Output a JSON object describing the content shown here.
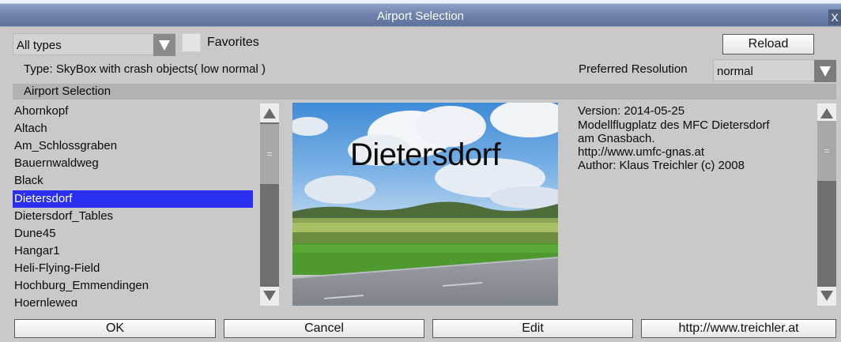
{
  "window": {
    "title": "Airport Selection",
    "close_glyph": "X",
    "close_icon": "close-icon"
  },
  "toolbar": {
    "type_filter": "All types",
    "favorites_label": "Favorites",
    "favorites_checked": false,
    "reload_label": "Reload"
  },
  "type_info": "Type: SkyBox with crash objects( low normal )",
  "resolution": {
    "label": "Preferred Resolution",
    "value": "normal"
  },
  "section_title": "Airport Selection",
  "airports": {
    "items": [
      "Ahornkopf",
      "Altach",
      "Am_Schlossgraben",
      "Bauernwaldweg",
      "Black",
      "Dietersdorf",
      "Dietersdorf_Tables",
      "Dune45",
      "Hangar1",
      "Heli-Flying-Field",
      "Hochburg_Emmendingen",
      "Hoernleweg"
    ],
    "selected": "Dietersdorf"
  },
  "preview": {
    "caption": "Dietersdorf"
  },
  "details": {
    "lines": [
      "Version: 2014-05-25",
      "Modellflugplatz des MFC Dietersdorf",
      "am Gnasbach.",
      "http://www.umfc-gnas.at",
      "Author: Klaus Treichler (c) 2008"
    ]
  },
  "scrollbar_grip": "=",
  "buttons": {
    "ok": "OK",
    "cancel": "Cancel",
    "edit": "Edit",
    "website": "http://www.treichler.at"
  },
  "colors": {
    "selection": "#2a2ef0",
    "titlebar": "#6f84ad",
    "background": "#c9c9c9"
  }
}
